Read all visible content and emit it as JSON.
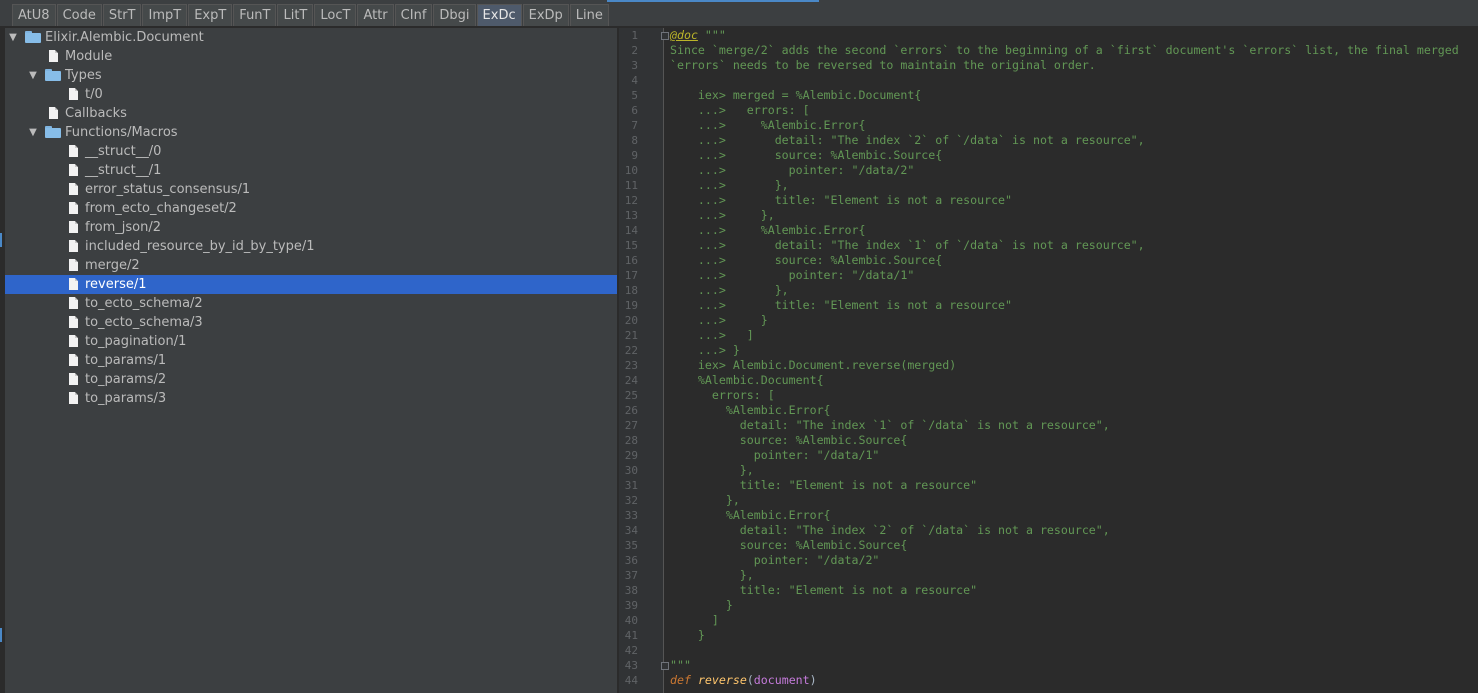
{
  "tabs": [
    {
      "label": "AtU8"
    },
    {
      "label": "Code"
    },
    {
      "label": "StrT"
    },
    {
      "label": "ImpT"
    },
    {
      "label": "ExpT"
    },
    {
      "label": "FunT"
    },
    {
      "label": "LitT"
    },
    {
      "label": "LocT"
    },
    {
      "label": "Attr"
    },
    {
      "label": "CInf"
    },
    {
      "label": "Dbgi"
    },
    {
      "label": "ExDc",
      "active": true
    },
    {
      "label": "ExDp"
    },
    {
      "label": "Line"
    }
  ],
  "tree": {
    "root": "Elixir.Alembic.Document",
    "module": "Module",
    "types": "Types",
    "types_items": [
      "t/0"
    ],
    "callbacks": "Callbacks",
    "functions": "Functions/Macros",
    "function_items": [
      "__struct__/0",
      "__struct__/1",
      "error_status_consensus/1",
      "from_ecto_changeset/2",
      "from_json/2",
      "included_resource_by_id_by_type/1",
      "merge/2",
      "reverse/1",
      "to_ecto_schema/2",
      "to_ecto_schema/3",
      "to_pagination/1",
      "to_params/1",
      "to_params/2",
      "to_params/3"
    ],
    "selected": "reverse/1"
  },
  "editor": {
    "doc_annotation": "@doc",
    "doc_open_quote": " \"\"\"",
    "doc_lines": [
      "Since `merge/2` adds the second `errors` to the beginning of a `first` document's `errors` list, the final merged",
      "`errors` needs to be reversed to maintain the original order.",
      "",
      "    iex> merged = %Alembic.Document{",
      "    ...>   errors: [",
      "    ...>     %Alembic.Error{",
      "    ...>       detail: \"The index `2` of `/data` is not a resource\",",
      "    ...>       source: %Alembic.Source{",
      "    ...>         pointer: \"/data/2\"",
      "    ...>       },",
      "    ...>       title: \"Element is not a resource\"",
      "    ...>     },",
      "    ...>     %Alembic.Error{",
      "    ...>       detail: \"The index `1` of `/data` is not a resource\",",
      "    ...>       source: %Alembic.Source{",
      "    ...>         pointer: \"/data/1\"",
      "    ...>       },",
      "    ...>       title: \"Element is not a resource\"",
      "    ...>     }",
      "    ...>   ]",
      "    ...> }",
      "    iex> Alembic.Document.reverse(merged)",
      "    %Alembic.Document{",
      "      errors: [",
      "        %Alembic.Error{",
      "          detail: \"The index `1` of `/data` is not a resource\",",
      "          source: %Alembic.Source{",
      "            pointer: \"/data/1\"",
      "          },",
      "          title: \"Element is not a resource\"",
      "        },",
      "        %Alembic.Error{",
      "          detail: \"The index `2` of `/data` is not a resource\",",
      "          source: %Alembic.Source{",
      "            pointer: \"/data/2\"",
      "          },",
      "          title: \"Element is not a resource\"",
      "        }",
      "      ]",
      "    }",
      ""
    ],
    "doc_close_quote": "\"\"\"",
    "def_keyword": "def",
    "def_name": "reverse",
    "def_open": "(",
    "def_param": "document",
    "def_close": ")",
    "line_numbers": [
      "1",
      "2",
      "3",
      "4",
      "5",
      "6",
      "7",
      "8",
      "9",
      "10",
      "11",
      "12",
      "13",
      "14",
      "15",
      "16",
      "17",
      "18",
      "19",
      "20",
      "21",
      "22",
      "23",
      "24",
      "25",
      "26",
      "27",
      "28",
      "29",
      "30",
      "31",
      "32",
      "33",
      "34",
      "35",
      "36",
      "37",
      "38",
      "39",
      "40",
      "41",
      "42",
      "43",
      "44"
    ]
  }
}
